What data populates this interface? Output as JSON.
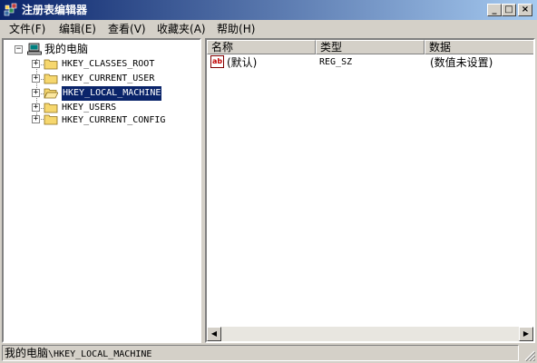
{
  "window": {
    "title": "注册表编辑器",
    "minimize_glyph": "_",
    "maximize_glyph": "□",
    "close_glyph": "×"
  },
  "menu": [
    {
      "label": "文件",
      "key": "(F)"
    },
    {
      "label": "编辑",
      "key": "(E)"
    },
    {
      "label": "查看",
      "key": "(V)"
    },
    {
      "label": "收藏夹",
      "key": "(A)"
    },
    {
      "label": "帮助",
      "key": "(H)"
    }
  ],
  "tree": {
    "root": "我的电脑",
    "root_expander": "−",
    "child_expander": "+",
    "children": [
      "HKEY_CLASSES_ROOT",
      "HKEY_CURRENT_USER",
      "HKEY_LOCAL_MACHINE",
      "HKEY_USERS",
      "HKEY_CURRENT_CONFIG"
    ],
    "selected_index": 2
  },
  "list": {
    "columns": [
      "名称",
      "类型",
      "数据"
    ],
    "rows": [
      {
        "name": "(默认)",
        "type": "REG_SZ",
        "data": "(数值未设置)",
        "icon": "string-value-icon",
        "icon_text": "ab"
      }
    ]
  },
  "scrollbar": {
    "left_glyph": "◀",
    "right_glyph": "▶"
  },
  "status": {
    "computer": "我的电脑",
    "path": "\\HKEY_LOCAL_MACHINE"
  },
  "colors": {
    "titlebar_start": "#0a246a",
    "titlebar_end": "#a6caf0",
    "face": "#d4d0c8",
    "selection": "#0a246a",
    "folder": "#f6d76e"
  }
}
